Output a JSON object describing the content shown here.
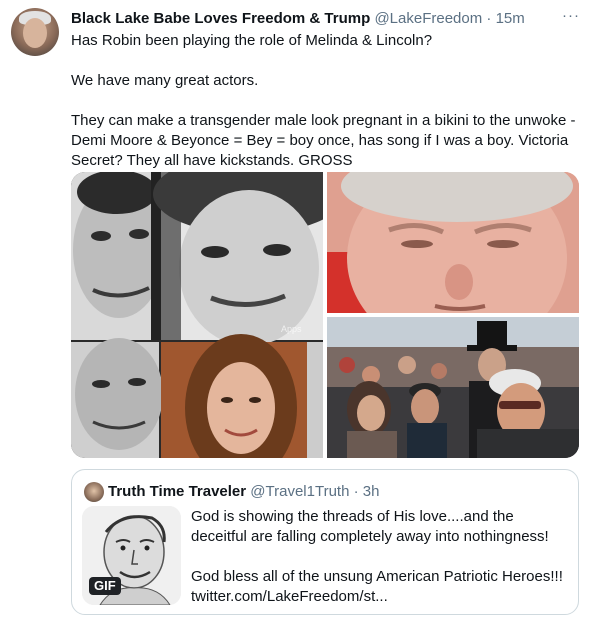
{
  "tweet": {
    "author": {
      "name": "Black Lake Babe Loves Freedom & Trump",
      "handle": "@LakeFreedom",
      "separator": "·",
      "time": "15m"
    },
    "more_icon": "more-horizontal-icon",
    "more_glyph": "···",
    "text": {
      "line1": "Has Robin been playing the role of Melinda & Lincoln?",
      "line2": "We have many great actors.",
      "line3": "They can make a transgender male look pregnant in a bikini to the unwoke - Demi Moore & Beyonce = Bey = boy once, has song if I was a boy.  Victoria Secret?  They all have kickstands.  GROSS"
    },
    "media": {
      "photo_count": 3,
      "watermark": "Apps"
    }
  },
  "quoted_tweet": {
    "author": {
      "name": "Truth Time Traveler",
      "handle": "@Travel1Truth",
      "separator": "·",
      "time": "3h"
    },
    "gif_label": "GIF",
    "text": {
      "line1": "God is showing the threads of His love....and the deceitful are falling completely away into nothingness!",
      "line2": "God bless all of the unsung American Patriotic Heroes!!!",
      "link": "twitter.com/LakeFreedom/st..."
    }
  },
  "colors": {
    "text_primary": "#0f1419",
    "text_secondary": "#5b7083",
    "border": "#cfd9de",
    "background": "#ffffff"
  }
}
